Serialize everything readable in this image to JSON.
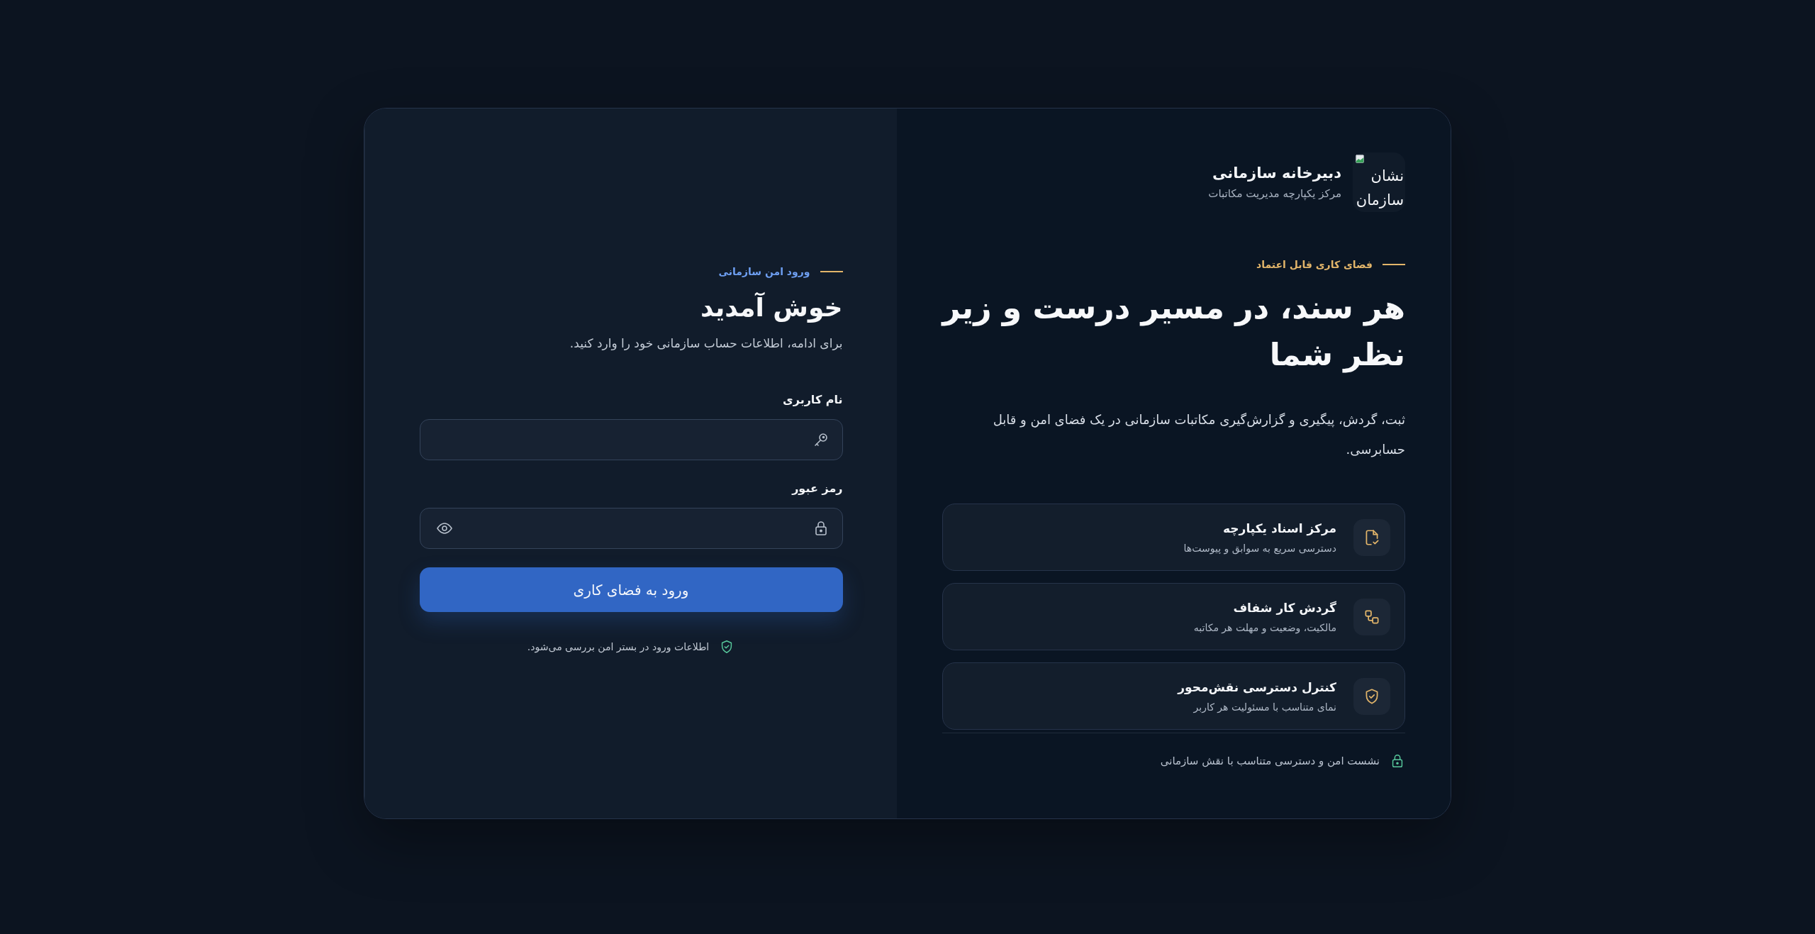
{
  "brand": {
    "logo_alt": "نشان سازمان",
    "title": "دبیرخانه سازمانی",
    "subtitle": "مرکز یکپارچه مدیریت مکاتبات"
  },
  "hero": {
    "tagline": "فضای کاری قابل اعتماد",
    "headline": "هر سند، در مسیر درست و زیر نظر شما",
    "description": "ثبت، گردش، پیگیری و گزارش‌گیری مکاتبات سازمانی در یک فضای امن و قابل حسابرسی."
  },
  "features": [
    {
      "title": "مرکز اسناد یکپارچه",
      "description": "دسترسی سریع به سوابق و پیوست‌ها"
    },
    {
      "title": "گردش کار شفاف",
      "description": "مالکیت، وضعیت و مهلت هر مکاتبه"
    },
    {
      "title": "کنترل دسترسی نقش‌محور",
      "description": "نمای متناسب با مسئولیت هر کاربر"
    }
  ],
  "session_note": "نشست امن و دسترسی متناسب با نقش سازمانی",
  "login": {
    "tagline": "ورود امن سازمانی",
    "title": "خوش آمدید",
    "subtitle": "برای ادامه، اطلاعات حساب سازمانی خود را وارد کنید.",
    "fields": [
      {
        "label": "نام کاربری",
        "kind": "username"
      },
      {
        "label": "رمز عبور",
        "kind": "password"
      }
    ],
    "submit": "ورود به فضای کاری",
    "note": "اطلاعات ورود در بستر امن بررسی می‌شود."
  }
}
